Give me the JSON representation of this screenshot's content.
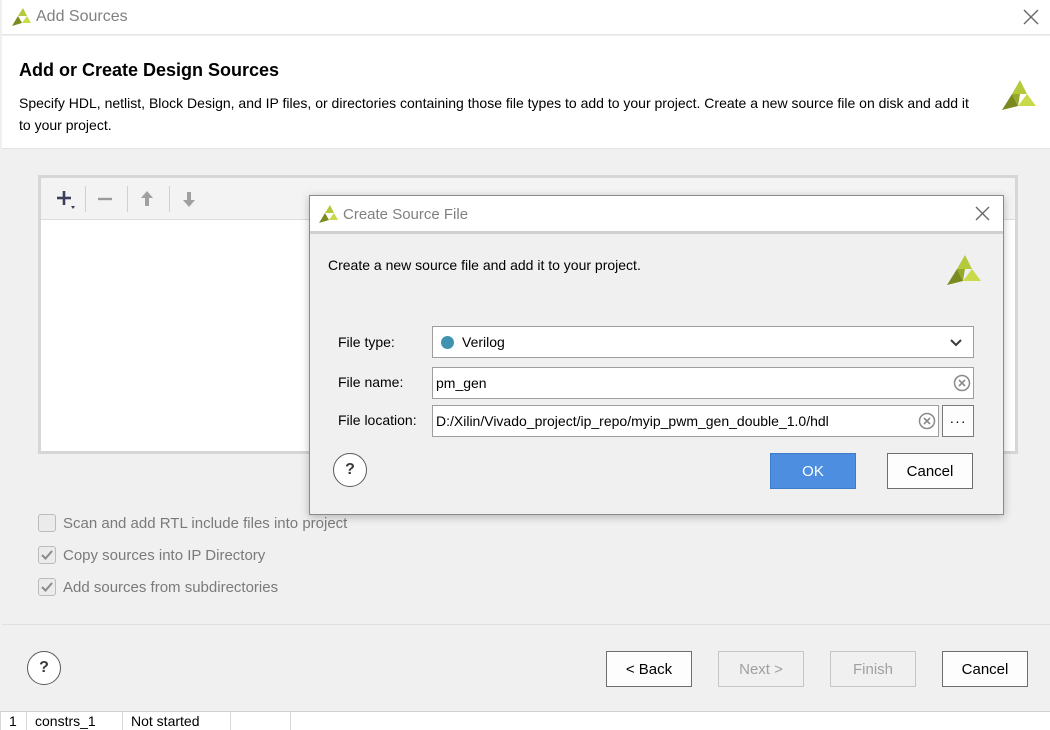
{
  "window": {
    "title": "Add Sources",
    "icons": {
      "app": "xilinx-logo-icon",
      "close": "close-icon"
    }
  },
  "header": {
    "title": "Add or Create Design Sources",
    "description": "Specify HDL, netlist, Block Design, and IP files, or directories containing those file types to add to your project. Create a new source file on disk and add it to your project."
  },
  "toolbar": {
    "add": "add-icon",
    "remove": "remove-icon",
    "move_up": "arrow-up-icon",
    "move_down": "arrow-down-icon"
  },
  "options": [
    {
      "label": "Scan and add RTL include files into project",
      "checked": false
    },
    {
      "label": "Copy sources into IP Directory",
      "checked": true
    },
    {
      "label": "Add sources from subdirectories",
      "checked": true
    }
  ],
  "footer": {
    "help": "?",
    "back": "< Back",
    "next": "Next >",
    "finish": "Finish",
    "cancel": "Cancel"
  },
  "modal": {
    "title": "Create Source File",
    "description": "Create a new source file and add it to your project.",
    "file_type_label": "File type:",
    "file_type_value": "Verilog",
    "file_name_label": "File name:",
    "file_name_value": "pm_gen",
    "file_location_label": "File location:",
    "file_location_value": "D:/Xilin/Vivado_project/ip_repo/myip_pwm_gen_double_1.0/hdl",
    "browse": "···",
    "help": "?",
    "ok": "OK",
    "cancel": "Cancel"
  },
  "background_table": {
    "cells": [
      "1",
      "constrs_1",
      "Not started"
    ]
  },
  "colors": {
    "accent": "#4d8ee0",
    "logo_green": "#b5c93a",
    "logo_dark": "#7a8a1e",
    "verilog_dot": "#3f93b0"
  }
}
